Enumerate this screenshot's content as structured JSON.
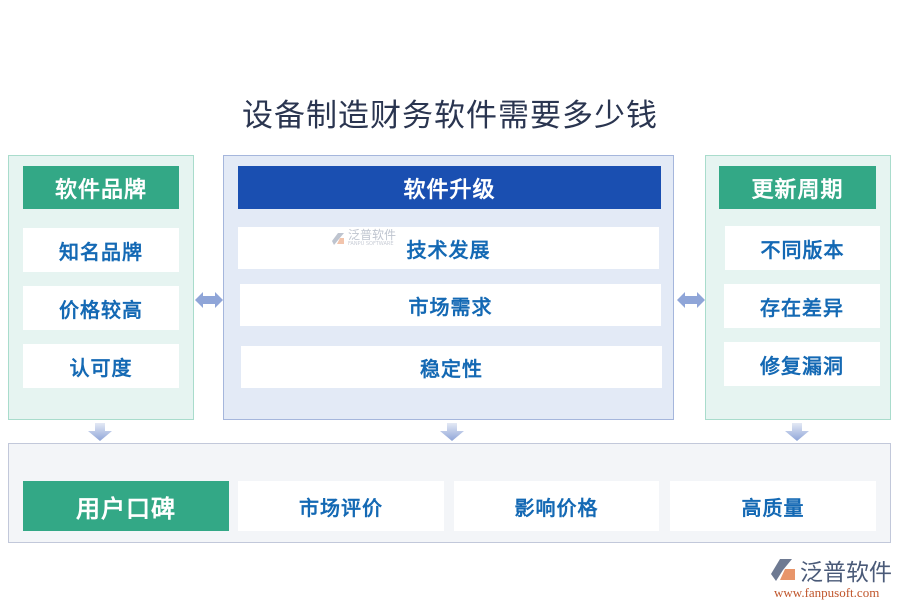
{
  "title": "设备制造财务软件需要多少钱",
  "left": {
    "header": "软件品牌",
    "items": [
      "知名品牌",
      "价格较高",
      "认可度"
    ]
  },
  "center": {
    "header": "软件升级",
    "items": [
      "技术发展",
      "市场需求",
      "稳定性"
    ],
    "watermark": {
      "cn": "泛普软件",
      "en": "FANPU SOFTWARE"
    }
  },
  "right": {
    "header": "更新周期",
    "items": [
      "不同版本",
      "存在差异",
      "修复漏洞"
    ]
  },
  "bottom": {
    "header": "用户口碑",
    "items": [
      "市场评价",
      "影响价格",
      "高质量"
    ]
  },
  "logo": {
    "name": "泛普软件",
    "url": "www.fanpusoft.com"
  },
  "colors": {
    "green": "#33a886",
    "blue": "#1a4fb1",
    "item_text": "#1469b4",
    "arrow": "#8fa5d8"
  }
}
